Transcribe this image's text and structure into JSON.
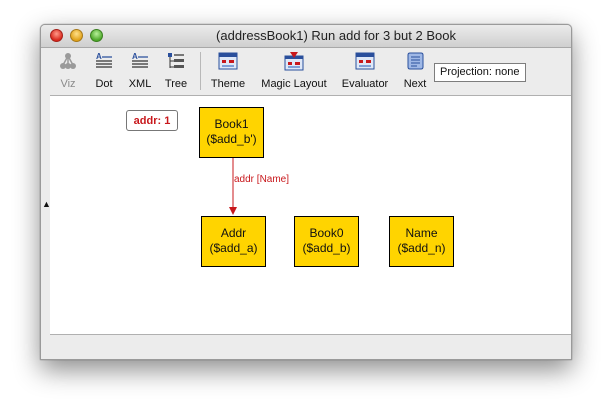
{
  "window": {
    "title": "(addressBook1) Run add for 3 but 2 Book"
  },
  "toolbar": {
    "viz_label": "Viz",
    "dot_label": "Dot",
    "xml_label": "XML",
    "tree_label": "Tree",
    "theme_label": "Theme",
    "magic_layout_label": "Magic Layout",
    "evaluator_label": "Evaluator",
    "next_label": "Next",
    "projection_label": "Projection: none"
  },
  "graph": {
    "badge": "addr: 1",
    "nodes": [
      {
        "title": "Book1",
        "sub": "($add_b')"
      },
      {
        "title": "Addr",
        "sub": "($add_a)"
      },
      {
        "title": "Book0",
        "sub": "($add_b)"
      },
      {
        "title": "Name",
        "sub": "($add_n)"
      }
    ],
    "edge_label": "addr [Name]"
  },
  "colors": {
    "node_fill": "#ffd400",
    "edge": "#c8181c"
  }
}
